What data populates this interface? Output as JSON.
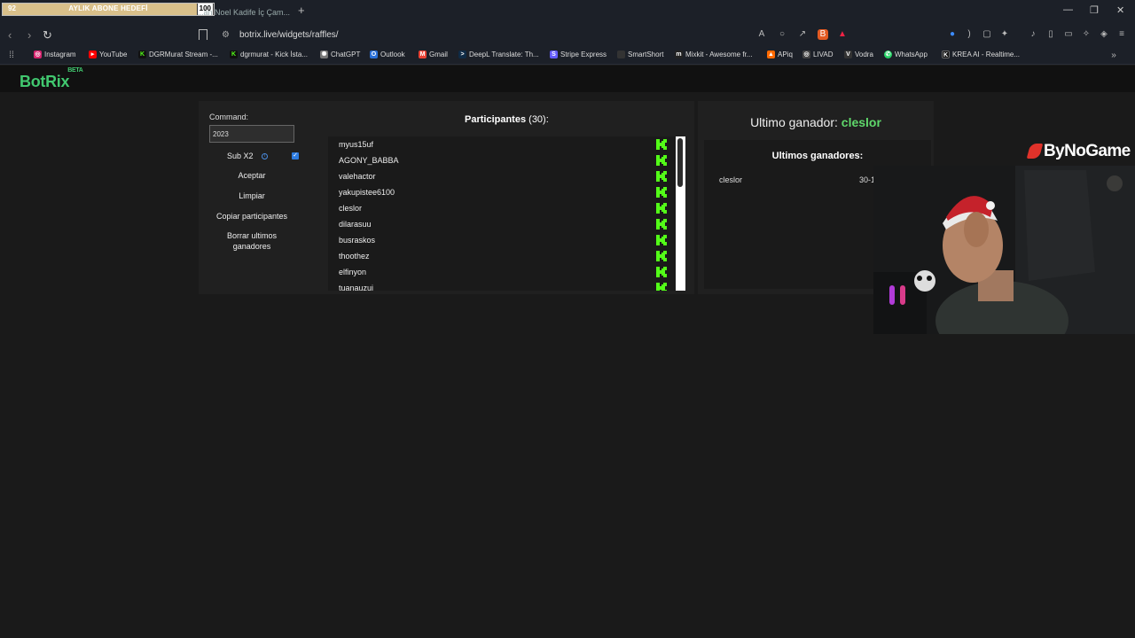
{
  "browser": {
    "sub_goal": {
      "current": "92",
      "label": "AYLIK ABONE HEDEFİ",
      "target": "100",
      "progress": 0.92
    },
    "active_tab_title": "...an Noel Kadife İç Çam...",
    "new_tab": "+",
    "window_controls": {
      "minimize": "—",
      "maximize": "❐",
      "close": "✕"
    },
    "url": "botrix.live/widgets/raffles/",
    "bookmarks": [
      {
        "label": "Instagram",
        "icon": "instagram-icon",
        "color": "#d6246e"
      },
      {
        "label": "YouTube",
        "icon": "youtube-icon",
        "color": "#ff0000"
      },
      {
        "label": "DGRMurat Stream -...",
        "icon": "kick-icon",
        "color": "#53fc18"
      },
      {
        "label": "dgrmurat - Kick İsta...",
        "icon": "kick-icon",
        "color": "#53fc18"
      },
      {
        "label": "ChatGPT",
        "icon": "chatgpt-icon",
        "color": "#777777"
      },
      {
        "label": "Outlook",
        "icon": "outlook-icon",
        "color": "#2a6fd6"
      },
      {
        "label": "Gmail",
        "icon": "gmail-icon",
        "color": "#ea4335"
      },
      {
        "label": "DeepL Translate: Th...",
        "icon": "deepl-icon",
        "color": "#0f2b46"
      },
      {
        "label": "Stripe Express",
        "icon": "stripe-icon",
        "color": "#635bff"
      },
      {
        "label": "SmartShort",
        "icon": "smartshort-icon",
        "color": "#333333"
      },
      {
        "label": "Mixkit - Awesome fr...",
        "icon": "mixkit-icon",
        "color": "#222222"
      },
      {
        "label": "APiq",
        "icon": "apiq-icon",
        "color": "#ff6a00"
      },
      {
        "label": "LIVAD",
        "icon": "livad-icon",
        "color": "#444444"
      },
      {
        "label": "Vodra",
        "icon": "vodra-icon",
        "color": "#333333"
      },
      {
        "label": "WhatsApp",
        "icon": "whatsapp-icon",
        "color": "#25d366"
      },
      {
        "label": "KREA AI - Realtime...",
        "icon": "krea-icon",
        "color": "#111111"
      }
    ]
  },
  "app": {
    "logo": "BotRix",
    "logo_badge": "BETA"
  },
  "raffle": {
    "command_label": "Command:",
    "command_value": "2023",
    "sub_x2_label": "Sub X2",
    "sub_x2_checked": true,
    "buttons": {
      "accept": "Aceptar",
      "clear": "Limpiar",
      "copy": "Copiar participantes",
      "delete_line1": "Borrar ultimos",
      "delete_line2": "ganadores"
    },
    "participants_title": "Participantes",
    "participants_count": "(30):",
    "participants": [
      "myus15uf",
      "AGONY_BABBA",
      "valehactor",
      "yakupistee6100",
      "cleslor",
      "dilarasuu",
      "busraskos",
      "thoothez",
      "elfinyon",
      "tuanauzui"
    ]
  },
  "winners": {
    "last_winner_label": "Ultimo ganador:",
    "last_winner": "cleslor",
    "title": "Ultimos ganadores:",
    "rows": [
      {
        "name": "cleslor",
        "date": "30-1"
      }
    ]
  },
  "overlay": {
    "sponsor": "ByNoGame"
  },
  "colors": {
    "accent_green": "#41c86f",
    "kick_green": "#53fc18",
    "checkbox_blue": "#2d7be0"
  }
}
